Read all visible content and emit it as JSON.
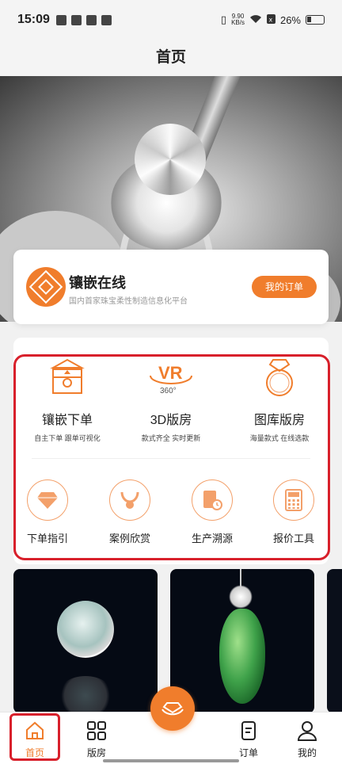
{
  "status_bar": {
    "time": "15:09",
    "network_speed_top": "9.90",
    "network_speed_unit": "KB/s",
    "battery": "26%"
  },
  "nav": {
    "title": "首页"
  },
  "brand": {
    "title": "镶嵌在线",
    "subtitle": "国内首家珠宝柔性制造信息化平台",
    "orders_button": "我的订单"
  },
  "main_menu": [
    {
      "label": "镶嵌下单",
      "desc": "自主下单 跟单可视化",
      "icon": "ring-box-icon"
    },
    {
      "label": "3D版房",
      "desc": "款式齐全 实时更新",
      "icon": "vr-360-icon",
      "badge": "360°"
    },
    {
      "label": "图库版房",
      "desc": "海量款式 在线选款",
      "icon": "diamond-ring-icon"
    }
  ],
  "sub_menu": [
    {
      "label": "下单指引",
      "icon": "diamond-icon"
    },
    {
      "label": "案例欣赏",
      "icon": "necklace-icon"
    },
    {
      "label": "生产溯源",
      "icon": "document-clock-icon"
    },
    {
      "label": "报价工具",
      "icon": "calculator-icon"
    }
  ],
  "tabs": [
    {
      "label": "首页",
      "icon": "home-icon",
      "active": true
    },
    {
      "label": "版房",
      "icon": "grid-icon",
      "active": false
    },
    {
      "label": "订单",
      "icon": "document-icon",
      "active": false
    },
    {
      "label": "我的",
      "icon": "user-icon",
      "active": false
    }
  ],
  "colors": {
    "accent": "#f07d2c",
    "highlight": "#d8202b"
  }
}
